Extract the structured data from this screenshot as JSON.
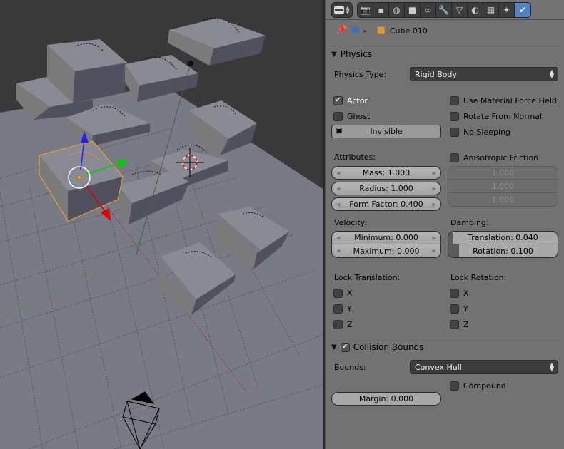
{
  "viewport": {
    "selected_object_outline_color": "#f5a623",
    "axis_colors": {
      "x": "#e00000",
      "y": "#00cc00",
      "z": "#2020ff"
    }
  },
  "header": {
    "editor_type_icon": "properties-editor-icon",
    "tabs": [
      {
        "name": "render",
        "icon": "camera-icon",
        "glyph": "📷",
        "active": false
      },
      {
        "name": "render-layers",
        "icon": "render-layers-icon",
        "glyph": "▪",
        "active": false
      },
      {
        "name": "world",
        "icon": "world-icon",
        "glyph": "◍",
        "active": false
      },
      {
        "name": "object",
        "icon": "cube-icon",
        "glyph": "■",
        "active": false
      },
      {
        "name": "constraints",
        "icon": "link-icon",
        "glyph": "∞",
        "active": false
      },
      {
        "name": "modifiers",
        "icon": "wrench-icon",
        "glyph": "🔧",
        "active": false
      },
      {
        "name": "object-data",
        "icon": "mesh-icon",
        "glyph": "▽",
        "active": false
      },
      {
        "name": "material",
        "icon": "material-icon",
        "glyph": "◐",
        "active": false
      },
      {
        "name": "texture",
        "icon": "texture-icon",
        "glyph": "▦",
        "active": false
      },
      {
        "name": "particles",
        "icon": "particles-icon",
        "glyph": "✦",
        "active": false
      },
      {
        "name": "physics",
        "icon": "physics-icon",
        "glyph": "✔",
        "active": true
      }
    ]
  },
  "breadcrumb": {
    "pin_icon": "pin-icon",
    "scene_icon": "scene-icon",
    "separator": "▸",
    "object_name": "Cube.010"
  },
  "physics": {
    "title": "Physics",
    "physics_type_label": "Physics Type:",
    "physics_type_value": "Rigid Body",
    "actor": {
      "label": "Actor",
      "checked": true
    },
    "ghost": {
      "label": "Ghost",
      "checked": false
    },
    "invisible": {
      "label": "Invisible"
    },
    "use_material_force_field": {
      "label": "Use Material Force Field",
      "checked": false
    },
    "rotate_from_normal": {
      "label": "Rotate From Normal",
      "checked": false
    },
    "no_sleeping": {
      "label": "No Sleeping",
      "checked": false
    },
    "attributes_label": "Attributes:",
    "mass": "Mass: 1.000",
    "radius": "Radius: 1.000",
    "form_factor": "Form Factor: 0.400",
    "anisotropic_friction": {
      "label": "Anisotropic Friction",
      "checked": false,
      "values": [
        "1.000",
        "1.000",
        "1.000"
      ]
    },
    "velocity_label": "Velocity:",
    "velocity_min": "Minimum: 0.000",
    "velocity_max": "Maximum: 0.000",
    "damping_label": "Damping:",
    "damping_translation": {
      "text": "Translation: 0.040",
      "value": 0.04
    },
    "damping_rotation": {
      "text": "Rotation: 0.100",
      "value": 0.1
    },
    "lock_translation_label": "Lock Translation:",
    "lock_rotation_label": "Lock Rotation:",
    "lock_translation": [
      {
        "axis": "X",
        "checked": false
      },
      {
        "axis": "Y",
        "checked": false
      },
      {
        "axis": "Z",
        "checked": false
      }
    ],
    "lock_rotation": [
      {
        "axis": "X",
        "checked": false
      },
      {
        "axis": "Y",
        "checked": false
      },
      {
        "axis": "Z",
        "checked": false
      }
    ]
  },
  "collision_bounds": {
    "title": "Collision Bounds",
    "enabled": true,
    "bounds_label": "Bounds:",
    "bounds_value": "Convex Hull",
    "margin": {
      "text": "Margin: 0.000",
      "value": 0.0
    },
    "compound": {
      "label": "Compound",
      "checked": false
    }
  }
}
